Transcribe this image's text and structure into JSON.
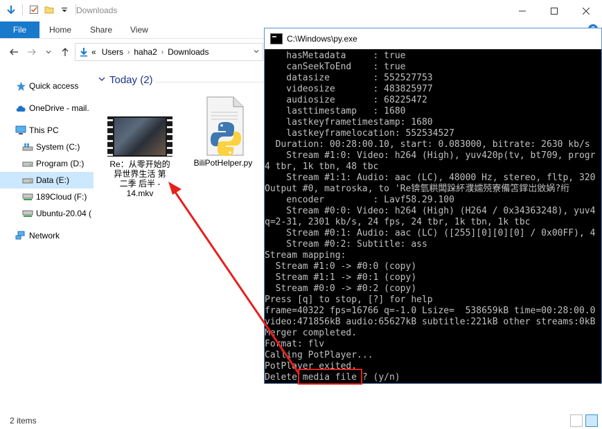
{
  "explorer": {
    "title": "Downloads",
    "ribbon": {
      "file": "File",
      "tabs": [
        "Home",
        "Share",
        "View"
      ],
      "help": "?"
    },
    "address": {
      "overflow": "«",
      "crumbs": [
        "Users",
        "haha2",
        "Downloads"
      ]
    },
    "nav": [
      {
        "label": "Quick access",
        "icon": "star-icon"
      },
      {
        "label": "OneDrive - mail.",
        "icon": "cloud-icon"
      },
      {
        "label": "This PC",
        "icon": "monitor-icon"
      },
      {
        "label": "System (C:)",
        "icon": "windows-drive-icon"
      },
      {
        "label": "Program (D:)",
        "icon": "drive-icon"
      },
      {
        "label": "Data (E:)",
        "icon": "drive-icon"
      },
      {
        "label": "189Cloud (F:)",
        "icon": "network-drive-icon"
      },
      {
        "label": "Ubuntu-20.04 (",
        "icon": "linux-drive-icon"
      },
      {
        "label": "Network",
        "icon": "network-icon"
      }
    ],
    "group": "Today (2)",
    "files": [
      {
        "name_lines": [
          "Re：从零开始的",
          "异世界生活 第",
          "二季 后半 -",
          "14.mkv"
        ],
        "icon": "video-thumbnail-icon"
      },
      {
        "name_lines": [
          "BiliPotHelper.py"
        ],
        "icon": "python-file-icon"
      }
    ],
    "status": "2 items"
  },
  "console": {
    "title": "C:\\Windows\\py.exe",
    "lines": [
      "    hasMetadata     : true",
      "    canSeekToEnd    : true",
      "    datasize        : 552527753",
      "    videosize       : 483825977",
      "    audiosize       : 68225472",
      "    lasttimestamp   : 1680",
      "    lastkeyframetimestamp: 1680",
      "    lastkeyframelocation: 552534527",
      "  Duration: 00:28:00.10, start: 0.083000, bitrate: 2630 kb/s",
      "    Stream #1:0: Video: h264 (High), yuv420p(tv, bt709, progr",
      "4 tbr, 1k tbn, 48 tbc",
      "    Stream #1:1: Audio: aac (LC), 48000 Hz, stereo, fltp, 320",
      "Output #0, matroska, to 'Re锛氫粠闆跺紑濮嬬殑寮備笘鐣岀敓娲?绗",
      "    encoder         : Lavf58.29.100",
      "    Stream #0:0: Video: h264 (High) (H264 / 0x34363248), yuv4",
      "q=2-31, 2301 kb/s, 24 fps, 24 tbr, 1k tbn, 1k tbc",
      "    Stream #0:1: Audio: aac (LC) ([255][0][0][0] / 0x00FF), 4",
      "    Stream #0:2: Subtitle: ass",
      "Stream mapping:",
      "  Stream #1:0 -> #0:0 (copy)",
      "  Stream #1:1 -> #0:1 (copy)",
      "  Stream #0:0 -> #0:2 (copy)",
      "Press [q] to stop, [?] for help",
      "frame=40322 fps=16766 q=-1.0 Lsize=  538659kB time=00:28:00.0",
      "video:471856kB audio:65627kB subtitle:221kB other streams:0kB",
      "Merger completed.",
      "Format: flv",
      "Calling PotPlayer...",
      "PotPlayer exited.",
      "Delete media file ? (y/n)"
    ]
  },
  "accent_colors": {
    "ribbon_file": "#1979ca",
    "selection": "#cce8ff",
    "annotation": "#e5201d",
    "group_header": "#1e3287"
  }
}
